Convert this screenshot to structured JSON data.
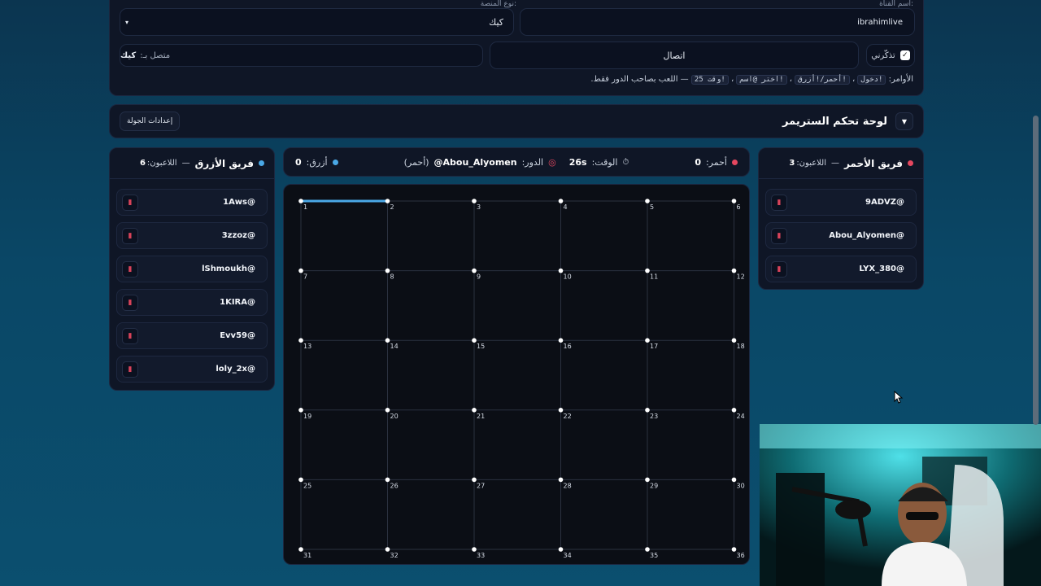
{
  "settings": {
    "channel_label": "اسم القناة:",
    "channel_value": "ibrahimlive",
    "platform_label": "نوع المنصة:",
    "platform_value": "كيك",
    "remember_label": "تذكّرني",
    "connect_label": "اتصال",
    "connected_prefix": "متصل بـ:",
    "connected_value": "كيك",
    "commands_label": "الأوامر:",
    "commands": [
      "!دخول",
      "!أحمر/!أزرق",
      "!اختر @اسم",
      "!وقت 25"
    ],
    "commands_note": "— اللعب بصاحب الدور فقط."
  },
  "control": {
    "title": "لوحة تحكم الستريمر",
    "round_settings_button": "إعدادات الجولة"
  },
  "score": {
    "red_label": "أحمر:",
    "red_score": "0",
    "time_label": "الوقت:",
    "time_value": "26s",
    "turn_label": "الدور:",
    "turn_player": "@Abou_Alyomen",
    "turn_team": "(أحمر)",
    "blue_label": "أزرق:",
    "blue_score": "0"
  },
  "red_team": {
    "name": "فريق الأحمر",
    "players_label": "اللاعبون:",
    "count": "3",
    "players": [
      "9ADVZ@",
      "Abou_Alyomen@",
      "LYX_380@"
    ]
  },
  "blue_team": {
    "name": "فريق الأزرق",
    "players_label": "اللاعبون:",
    "count": "6",
    "players": [
      "1Aws@",
      "3zzoz@",
      "lShmoukh@",
      "1KIRA@",
      "Evv59@",
      "loly_2x@"
    ]
  },
  "board": {
    "rows": 6,
    "cols": 6,
    "dot_labels": [
      "1",
      "2",
      "3",
      "4",
      "5",
      "6",
      "7",
      "8",
      "9",
      "10",
      "11",
      "12",
      "13",
      "14",
      "15",
      "16",
      "17",
      "18",
      "19",
      "20",
      "21",
      "22",
      "23",
      "24",
      "25",
      "26",
      "27",
      "28",
      "29",
      "30",
      "31",
      "32",
      "33",
      "34",
      "35",
      "36"
    ],
    "claimed_lines": [
      {
        "from": 1,
        "to": 2,
        "team": "blue"
      }
    ]
  },
  "colors": {
    "red": "#e5475f",
    "blue": "#4aa8e6",
    "panel": "#0f1626"
  }
}
